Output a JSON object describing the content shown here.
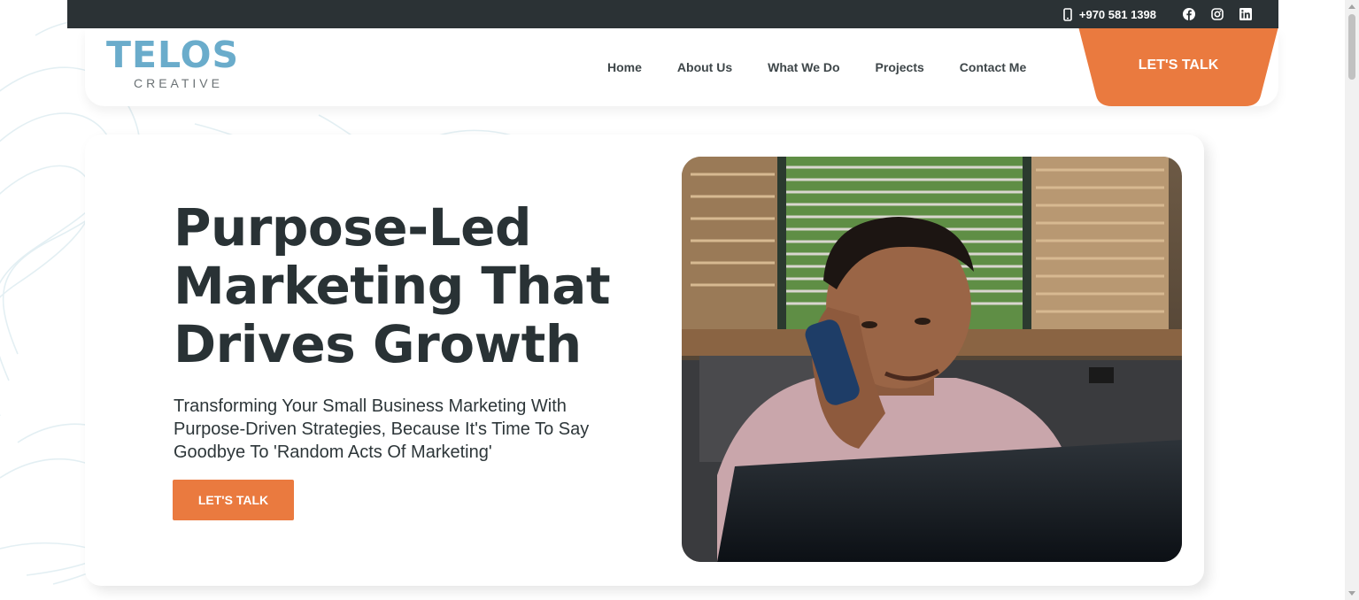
{
  "topbar": {
    "phone": "+970 581 1398",
    "icons": [
      "phone-icon",
      "facebook-icon",
      "instagram-icon",
      "linkedin-icon"
    ]
  },
  "logo": {
    "word": "TELOS",
    "sub": "CREATIVE"
  },
  "nav": {
    "items": [
      "Home",
      "About Us",
      "What We Do",
      "Projects",
      "Contact Me"
    ],
    "cta": "LET'S TALK"
  },
  "hero": {
    "title": "Purpose-Led Marketing That Drives Growth",
    "subtitle": "Transforming Your Small Business Marketing With Purpose-Driven Strategies, Because It's Time To Say Goodbye To 'Random Acts Of Marketing'",
    "button": "LET'S TALK"
  },
  "colors": {
    "accent": "#ea7a3f",
    "topbar": "#2b3235",
    "logo": "#6aaccb",
    "heading": "#293235"
  }
}
